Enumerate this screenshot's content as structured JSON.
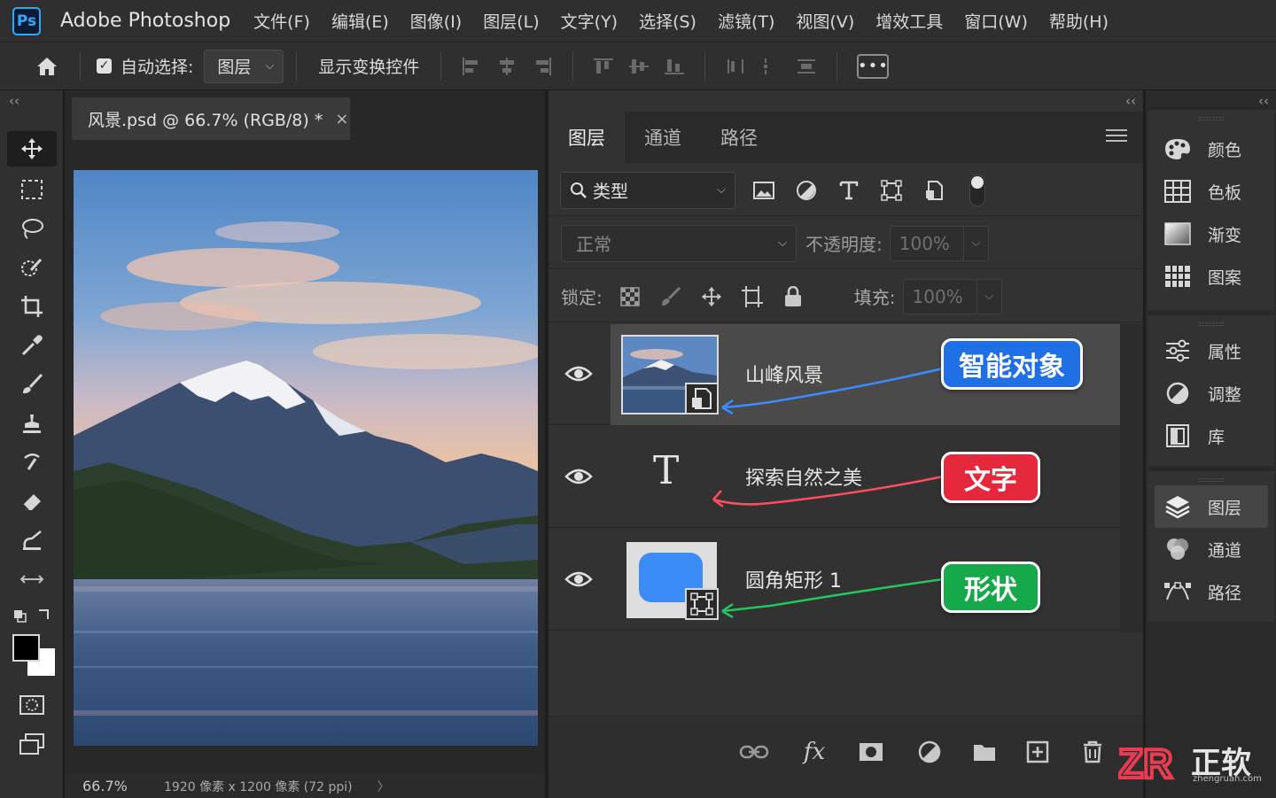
{
  "app": {
    "logo": "Ps",
    "name": "Adobe Photoshop"
  },
  "menu": [
    "文件(F)",
    "编辑(E)",
    "图像(I)",
    "图层(L)",
    "文字(Y)",
    "选择(S)",
    "滤镜(T)",
    "视图(V)",
    "增效工具",
    "窗口(W)",
    "帮助(H)"
  ],
  "options": {
    "auto_select_checked": true,
    "auto_select_label": "自动选择:",
    "auto_select_value": "图层",
    "show_transform_label": "显示变换控件",
    "more_label": "•••"
  },
  "toolbar": {
    "collapse": "‹‹",
    "tools": [
      "move-tool-icon",
      "marquee-tool-icon",
      "lasso-tool-icon",
      "quick-select-tool-icon",
      "crop-tool-icon",
      "eyedropper-tool-icon",
      "brush-tool-icon",
      "clone-stamp-tool-icon",
      "history-brush-tool-icon",
      "eraser-tool-icon",
      "gradient-tool-icon",
      "more-tools-icon"
    ],
    "foreground_color": "#000000",
    "background_color": "#ffffff"
  },
  "document": {
    "tab_title": "风景.psd @ 66.7% (RGB/8) *",
    "close": "×",
    "zoom": "66.7%",
    "info": "1920 像素 x 1200 像素 (72 ppi)",
    "info_arrow": "〉"
  },
  "layers_panel": {
    "collapse": "‹‹",
    "tabs": [
      "图层",
      "通道",
      "路径"
    ],
    "active_tab": "图层",
    "filter_label": "类型",
    "blend_mode": "正常",
    "opacity_label": "不透明度:",
    "opacity_value": "100%",
    "lock_label": "锁定:",
    "fill_label": "填充:",
    "fill_value": "100%",
    "layers": [
      {
        "name": "山峰风景",
        "type": "smart-object",
        "visible": true,
        "selected": true,
        "badge": "智能对象",
        "badge_color": "#1f6fe5",
        "arrow_color": "#3a8dff"
      },
      {
        "name": "探索自然之美",
        "type": "text",
        "visible": true,
        "selected": false,
        "badge": "文字",
        "badge_color": "#e5283c",
        "arrow_color": "#ff4d5e",
        "thumb_glyph": "T"
      },
      {
        "name": "圆角矩形 1",
        "type": "shape",
        "visible": true,
        "selected": false,
        "badge": "形状",
        "badge_color": "#16a94a",
        "arrow_color": "#22c55e",
        "shape_color": "#3b8cf6"
      }
    ]
  },
  "right_dock": {
    "collapse": "‹‹",
    "group1": [
      "颜色",
      "色板",
      "渐变",
      "图案"
    ],
    "group2": [
      "属性",
      "调整",
      "库"
    ],
    "group3": [
      "图层",
      "通道",
      "路径"
    ],
    "active": "图层"
  },
  "watermark": {
    "mark": "ZR",
    "text": "正软",
    "sub": "zhengruan.com"
  }
}
